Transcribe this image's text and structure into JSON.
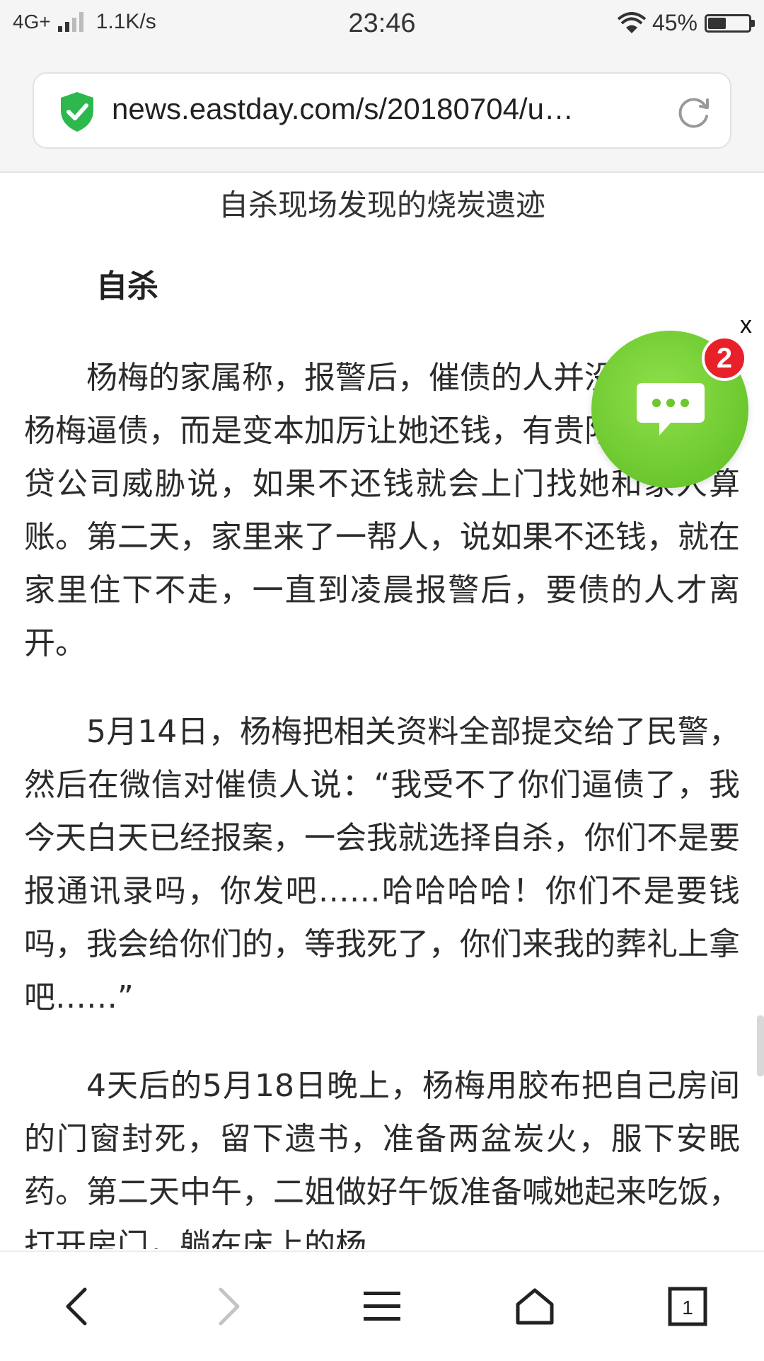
{
  "status_bar": {
    "network": "4G+",
    "speed": "1.1K/s",
    "time": "23:46",
    "battery": "45%",
    "battery_level": 0.45
  },
  "browser": {
    "url": "news.eastday.com/s/20180704/u…",
    "tab_count": "1"
  },
  "article": {
    "image_caption": "自杀现场发现的烧炭遗迹",
    "section_heading": "自杀",
    "paragraphs": [
      "杨梅的家属称，报警后，催债的人并没有停止向杨梅逼债，而是变本加厉让她还钱，有贵阳当地的借贷公司威胁说，如果不还钱就会上门找她和家人算账。第二天，家里来了一帮人，说如果不还钱，就在家里住下不走，一直到凌晨报警后，要债的人才离开。",
      "5月14日，杨梅把相关资料全部提交给了民警，然后在微信对催债人说：“我受不了你们逼债了，我今天白天已经报案，一会我就选择自杀，你们不是要报通讯录吗，你发吧……哈哈哈哈！你们不是要钱吗，我会给你们的，等我死了，你们来我的葬礼上拿吧……”",
      "4天后的5月18日晚上，杨梅用胶布把自己房间的门窗封死，留下遗书，准备两盆炭火，服下安眠药。第二天中午，二姐做好午饭准备喊她起来吃饭，打开房门，躺在床上的杨"
    ]
  },
  "chat_widget": {
    "badge_count": "2",
    "close_label": "x"
  },
  "colors": {
    "accent_green": "#5cbd22",
    "badge_red": "#e8202a",
    "shield_green": "#2db84d"
  },
  "icons": [
    "shield-check-icon",
    "reload-icon",
    "chat-bubble-icon",
    "back-icon",
    "forward-icon",
    "menu-icon",
    "home-icon",
    "tabs-icon"
  ]
}
